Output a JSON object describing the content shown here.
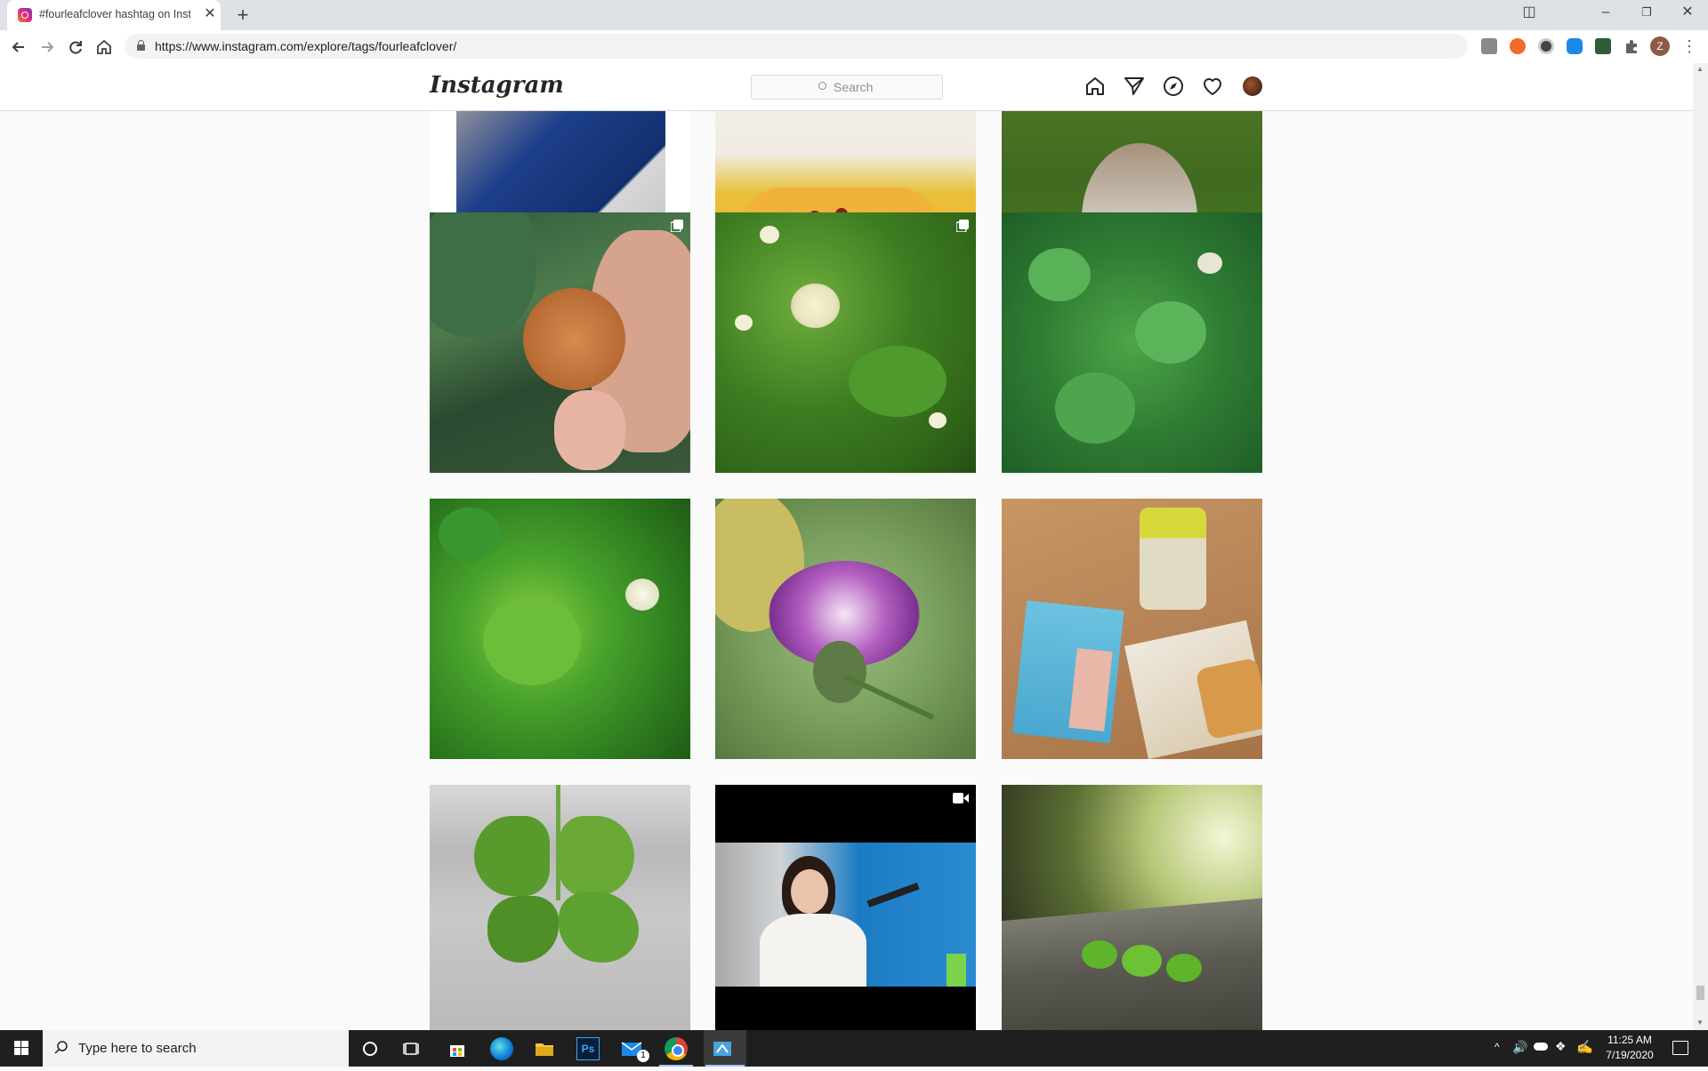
{
  "browser": {
    "tab_title": "#fourleafclover hashtag on Instagram",
    "tab_close": "✕",
    "new_tab": "+",
    "url": "https://www.instagram.com/explore/tags/fourleafclover/",
    "profile_initial": "Z"
  },
  "window_controls": {
    "tile": "◫",
    "minimize": "–",
    "restore": "❐",
    "close": "✕"
  },
  "instagram": {
    "logo": "Instagram",
    "search_placeholder": "Search",
    "nav_icons": [
      "home-icon",
      "direct-icon",
      "explore-icon",
      "activity-heart-icon",
      "profile-avatar"
    ]
  },
  "posts": [
    {
      "row": 0,
      "col": 0,
      "subject": "person in blue jeans with tag",
      "badge": null
    },
    {
      "row": 0,
      "col": 1,
      "subject": "yellow toy submarine",
      "badge": null
    },
    {
      "row": 0,
      "col": 2,
      "subject": "dog on grass",
      "badge": null
    },
    {
      "row": 1,
      "col": 0,
      "subject": "wooden clover token held in hand",
      "badge": "carousel"
    },
    {
      "row": 1,
      "col": 1,
      "subject": "white clover flowers",
      "badge": "carousel"
    },
    {
      "row": 1,
      "col": 2,
      "subject": "clover patch",
      "badge": null
    },
    {
      "row": 2,
      "col": 0,
      "subject": "clover closeup with white flower",
      "badge": null
    },
    {
      "row": 2,
      "col": 1,
      "subject": "butterfly on purple flower",
      "badge": null
    },
    {
      "row": 2,
      "col": 2,
      "subject": "book, drink and waffle on table",
      "badge": null
    },
    {
      "row": 3,
      "col": 0,
      "subject": "four leaf clover on sand",
      "badge": null
    },
    {
      "row": 3,
      "col": 1,
      "subject": "woman at radio microphone",
      "badge": "video"
    },
    {
      "row": 3,
      "col": 2,
      "subject": "clover sprouts on wooden bench",
      "badge": null
    }
  ],
  "taskbar": {
    "search_placeholder": "Type here to search",
    "mail_badge": "1",
    "time": "11:25 AM",
    "date": "7/19/2020"
  }
}
